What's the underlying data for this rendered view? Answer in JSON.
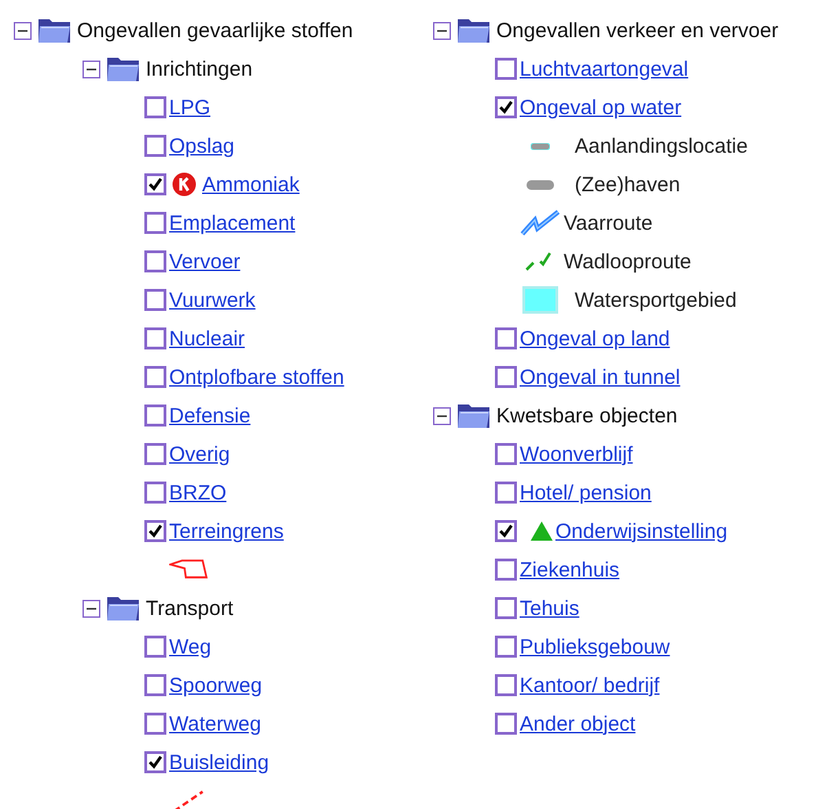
{
  "columns": [
    [
      {
        "label": "Ongevallen gevaarlijke stoffen",
        "expanded": true,
        "children": [
          {
            "kind": "group",
            "label": "Inrichtingen",
            "expanded": true,
            "children": [
              {
                "kind": "layer",
                "label": "LPG",
                "checked": false
              },
              {
                "kind": "layer",
                "label": "Opslag",
                "checked": false
              },
              {
                "kind": "layer",
                "label": "Ammoniak",
                "checked": true,
                "badge": {
                  "kind": "k-disc"
                }
              },
              {
                "kind": "layer",
                "label": "Emplacement",
                "checked": false
              },
              {
                "kind": "layer",
                "label": "Vervoer",
                "checked": false
              },
              {
                "kind": "layer",
                "label": "Vuurwerk",
                "checked": false
              },
              {
                "kind": "layer",
                "label": "Nucleair",
                "checked": false
              },
              {
                "kind": "layer",
                "label": "Ontplofbare stoffen",
                "checked": false
              },
              {
                "kind": "layer",
                "label": "Defensie",
                "checked": false
              },
              {
                "kind": "layer",
                "label": "Overig",
                "checked": false
              },
              {
                "kind": "layer",
                "label": "BRZO",
                "checked": false
              },
              {
                "kind": "layer",
                "label": "Terreingrens",
                "checked": true,
                "legend": [
                  {
                    "kind": "polygon"
                  }
                ]
              }
            ]
          },
          {
            "kind": "group",
            "label": "Transport",
            "expanded": true,
            "children": [
              {
                "kind": "layer",
                "label": "Weg",
                "checked": false
              },
              {
                "kind": "layer",
                "label": "Spoorweg",
                "checked": false
              },
              {
                "kind": "layer",
                "label": "Waterweg",
                "checked": false
              },
              {
                "kind": "layer",
                "label": "Buisleiding",
                "checked": true,
                "legend": [
                  {
                    "kind": "dashed"
                  }
                ]
              }
            ]
          }
        ]
      }
    ],
    [
      {
        "label": "Ongevallen verkeer en vervoer",
        "expanded": true,
        "children": [
          {
            "kind": "layer",
            "label": "Luchtvaartongeval",
            "checked": false
          },
          {
            "kind": "layer",
            "label": "Ongeval op water",
            "checked": true,
            "legend": [
              {
                "kind": "pill",
                "label": "Aanlandingslocatie"
              },
              {
                "kind": "widepill",
                "label": "(Zee)haven"
              },
              {
                "kind": "zigzag",
                "label": "Vaarroute"
              },
              {
                "kind": "dashpair",
                "label": "Wadlooproute"
              },
              {
                "kind": "square",
                "label": "Watersportgebied"
              }
            ]
          },
          {
            "kind": "layer",
            "label": "Ongeval op land",
            "checked": false
          },
          {
            "kind": "layer",
            "label": "Ongeval in tunnel",
            "checked": false
          }
        ]
      },
      {
        "label": "Kwetsbare objecten",
        "expanded": true,
        "children": [
          {
            "kind": "layer",
            "label": "Woonverblijf",
            "checked": false
          },
          {
            "kind": "layer",
            "label": "Hotel/ pension",
            "checked": false
          },
          {
            "kind": "layer",
            "label": "Onderwijsinstelling",
            "checked": true,
            "badge": {
              "kind": "triangle"
            }
          },
          {
            "kind": "layer",
            "label": "Ziekenhuis",
            "checked": false
          },
          {
            "kind": "layer",
            "label": "Tehuis",
            "checked": false
          },
          {
            "kind": "layer",
            "label": "Publieksgebouw",
            "checked": false
          },
          {
            "kind": "layer",
            "label": "Kantoor/ bedrijf",
            "checked": false
          },
          {
            "kind": "layer",
            "label": "Ander object",
            "checked": false
          }
        ]
      }
    ]
  ]
}
